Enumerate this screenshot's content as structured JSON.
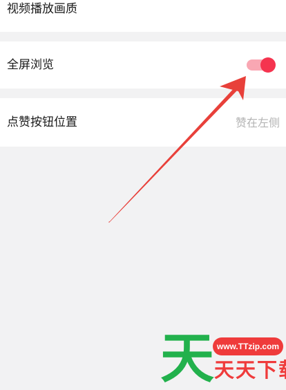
{
  "settings": {
    "items": [
      {
        "label": "视频播放画质"
      },
      {
        "label": "全屏浏览",
        "toggle_on": true
      },
      {
        "label": "点赞按钮位置",
        "value": "赞在左侧"
      }
    ]
  },
  "colors": {
    "page_background": "#f2f2f3",
    "toggle_track": "#f9a7b3",
    "toggle_knob": "#f5344f",
    "annotation_arrow": "#e8403a",
    "watermark_green": "#22b14c",
    "watermark_red": "#ef3b3b"
  },
  "watermark": {
    "logo_char": "天",
    "url": "www.TTzip.com",
    "name": "天天下载"
  }
}
